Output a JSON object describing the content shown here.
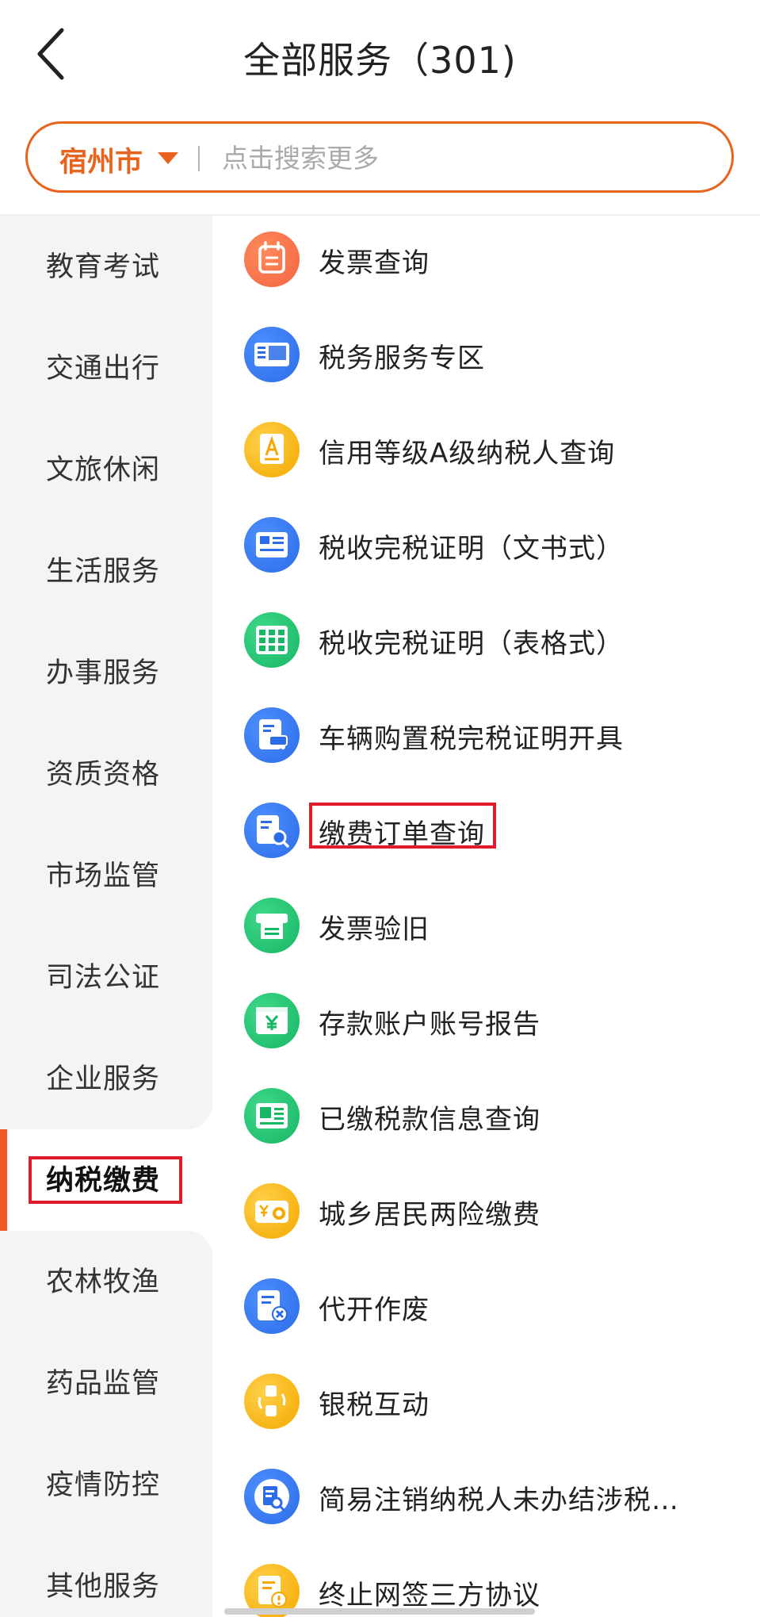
{
  "header": {
    "title": "全部服务（301)"
  },
  "search": {
    "city": "宿州市",
    "placeholder": "点击搜索更多"
  },
  "sidebar": {
    "items": [
      {
        "label": "教育考试"
      },
      {
        "label": "交通出行"
      },
      {
        "label": "文旅休闲"
      },
      {
        "label": "生活服务"
      },
      {
        "label": "办事服务"
      },
      {
        "label": "资质资格"
      },
      {
        "label": "市场监管"
      },
      {
        "label": "司法公证"
      },
      {
        "label": "企业服务"
      },
      {
        "label": "纳税缴费"
      },
      {
        "label": "农林牧渔"
      },
      {
        "label": "药品监管"
      },
      {
        "label": "疫情防控"
      },
      {
        "label": "其他服务"
      }
    ],
    "active_index": 9
  },
  "services": [
    {
      "label": "发票查询",
      "icon": "calendar-icon",
      "color": "#f26541"
    },
    {
      "label": "税务服务专区",
      "icon": "tax-card-icon",
      "color": "#2c6ce8"
    },
    {
      "label": "信用等级A级纳税人查询",
      "icon": "a-grade-icon",
      "color": "#f4a800"
    },
    {
      "label": "税收完税证明（文书式）",
      "icon": "tax-certificate-icon",
      "color": "#2c6ce8"
    },
    {
      "label": "税收完税证明（表格式）",
      "icon": "tax-table-icon",
      "color": "#16b765"
    },
    {
      "label": "车辆购置税完税证明开具",
      "icon": "vehicle-tax-icon",
      "color": "#2c6ce8"
    },
    {
      "label": "缴费订单查询",
      "icon": "order-search-icon",
      "color": "#2c6ce8"
    },
    {
      "label": "发票验旧",
      "icon": "printer-icon",
      "color": "#16b765"
    },
    {
      "label": "存款账户账号报告",
      "icon": "yuan-account-icon",
      "color": "#16b765"
    },
    {
      "label": "已缴税款信息查询",
      "icon": "paid-tax-icon",
      "color": "#16b765"
    },
    {
      "label": "城乡居民两险缴费",
      "icon": "insurance-wallet-icon",
      "color": "#f4a800"
    },
    {
      "label": "代开作废",
      "icon": "void-document-icon",
      "color": "#2c6ce8"
    },
    {
      "label": "银税互动",
      "icon": "bank-tax-exchange-icon",
      "color": "#f4a800"
    },
    {
      "label": "简易注销纳税人未办结涉税…",
      "icon": "deregister-search-icon",
      "color": "#2c6ce8"
    },
    {
      "label": "终止网签三方协议",
      "icon": "terminate-agreement-icon",
      "color": "#f4a800"
    }
  ]
}
